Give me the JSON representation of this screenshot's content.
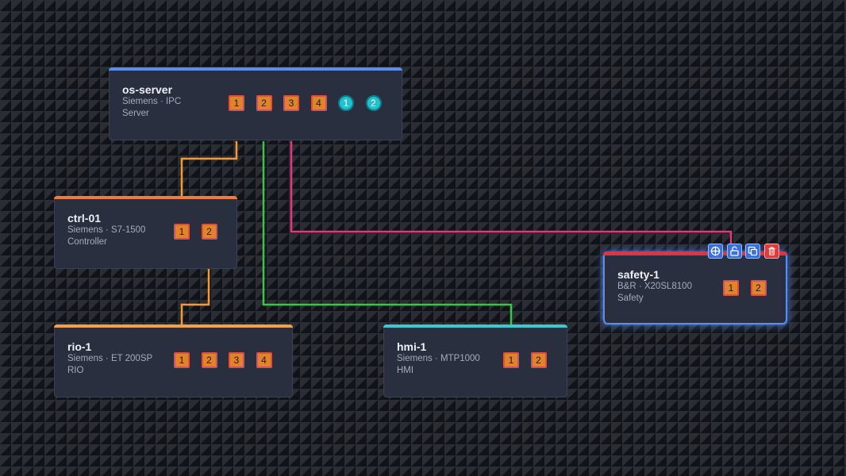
{
  "colors": {
    "server": "#5b8cf0",
    "controller": "#f07a3a",
    "rio": "#f0a24a",
    "hmi": "#3ec7d0",
    "safety": "#ee2f3a",
    "wire_orange": "#f59a2b",
    "wire_green": "#34c84a",
    "wire_pink": "#e8357f"
  },
  "nodes": {
    "os_server": {
      "name": "os-server",
      "vendor": "Siemens · IPC",
      "role": "Server",
      "ports": [
        {
          "label": "1",
          "shape": "square"
        },
        {
          "label": "2",
          "shape": "square"
        },
        {
          "label": "3",
          "shape": "square"
        },
        {
          "label": "4",
          "shape": "square"
        },
        {
          "label": "1",
          "shape": "circle"
        },
        {
          "label": "2",
          "shape": "circle"
        }
      ]
    },
    "ctrl_01": {
      "name": "ctrl-01",
      "vendor": "Siemens · S7-1500",
      "role": "Controller",
      "ports": [
        {
          "label": "1",
          "shape": "square"
        },
        {
          "label": "2",
          "shape": "square"
        }
      ]
    },
    "rio_1": {
      "name": "rio-1",
      "vendor": "Siemens · ET 200SP",
      "role": "RIO",
      "ports": [
        {
          "label": "1",
          "shape": "square"
        },
        {
          "label": "2",
          "shape": "square"
        },
        {
          "label": "3",
          "shape": "square"
        },
        {
          "label": "4",
          "shape": "square"
        }
      ]
    },
    "hmi_1": {
      "name": "hmi-1",
      "vendor": "Siemens · MTP1000",
      "role": "HMI",
      "ports": [
        {
          "label": "1",
          "shape": "square"
        },
        {
          "label": "2",
          "shape": "square"
        }
      ]
    },
    "safety_1": {
      "name": "safety-1",
      "vendor": "B&R · X20SL8100",
      "role": "Safety",
      "ports": [
        {
          "label": "1",
          "shape": "square"
        },
        {
          "label": "2",
          "shape": "square"
        }
      ]
    }
  },
  "toolbar": [
    "target-icon",
    "unlock-icon",
    "duplicate-icon",
    "delete-icon"
  ]
}
